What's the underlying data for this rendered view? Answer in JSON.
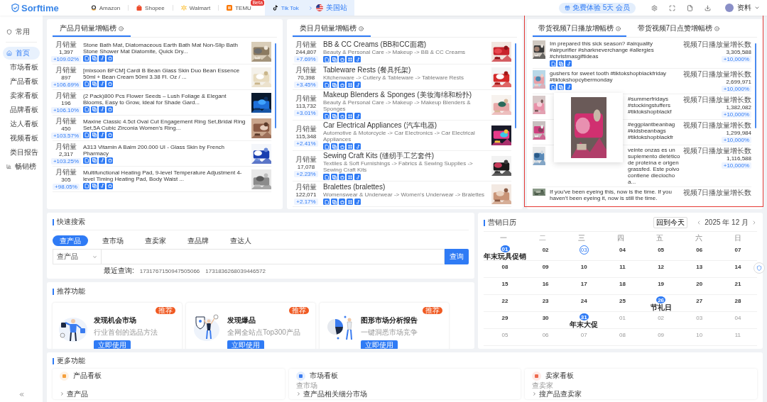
{
  "topbar": {
    "logo": "Sorftime",
    "platforms": [
      {
        "label": "Amazon",
        "selected": false
      },
      {
        "label": "Shopee",
        "selected": false
      },
      {
        "label": "Walmart",
        "selected": false
      },
      {
        "label": "TEMU",
        "selected": false,
        "badge": "Beta"
      },
      {
        "label": "Tik Tok",
        "selected": true,
        "site": "美国站"
      }
    ],
    "promo": "免费体验 5天 会员",
    "user": "资料"
  },
  "sidebar": {
    "items": [
      {
        "label": "常用",
        "selected": false
      },
      {
        "label": "首页",
        "selected": true
      },
      {
        "label": "市场看板",
        "selected": false
      },
      {
        "label": "产品看板",
        "selected": false
      },
      {
        "label": "卖家看板",
        "selected": false
      },
      {
        "label": "品牌看板",
        "selected": false
      },
      {
        "label": "达人看板",
        "selected": false
      },
      {
        "label": "视频看板",
        "selected": false
      },
      {
        "label": "类目报告",
        "selected": false
      },
      {
        "label": "畅销榜",
        "selected": false
      }
    ]
  },
  "product_ranking": {
    "title": "产品月销量增幅榜",
    "rows": [
      {
        "metric_label": "月销量",
        "sales": "1,397",
        "growth": "+109.02%",
        "title": "Stone Bath Mat, Diatomaceous Earth Bath Mat Non-Slip Bath Stone Shower Mat Diatomite, Quick Dry..."
      },
      {
        "metric_label": "月销量",
        "sales": "897",
        "growth": "+106.69%",
        "title": "[mixsoon BFCM] Cardi B Bean Glass Skin Duo Bean Essence 50ml + Bean Cream 50ml 3.38 Fl. Oz / ..."
      },
      {
        "metric_label": "月销量",
        "sales": "196",
        "growth": "+106.10%",
        "title": "(2 Pack)800 Pcs Flower Seeds – Lush Foliage & Elegant Blooms, Easy to Grow, Ideal for Shade Gard..."
      },
      {
        "metric_label": "月销量",
        "sales": "450",
        "growth": "+103.57%",
        "title": "Maxine Classic 4.5ct Oval Cut Engagement Ring Set,Bridal Ring Set,5A Cubic Zirconia Women's Ring..."
      },
      {
        "metric_label": "月销量",
        "sales": "2,317",
        "growth": "+103.25%",
        "title": "A313 Vitamin A Balm 200.000 UI - Glass Skin by French Pharmacy"
      },
      {
        "metric_label": "月销量",
        "sales": "305",
        "growth": "+98.05%",
        "title": "Multifunctional Heating Pad, 9-level Temperature Adjustment 4-level Timing Heating Pad, Body Waist ..."
      }
    ]
  },
  "category_ranking": {
    "title": "类目月销量增幅榜",
    "rows": [
      {
        "metric_label": "月销量",
        "sales": "244,807",
        "growth": "+7.69%",
        "title": "BB & CC Creams (BB和CC面霜)",
        "path": "Beauty & Personal Care -> Makeup -> BB & CC Creams"
      },
      {
        "metric_label": "月销量",
        "sales": "70,398",
        "growth": "+3.45%",
        "title": "Tableware Rests (餐具托架)",
        "path": "Kitchenware -> Cutlery & Tableware -> Tableware Rests"
      },
      {
        "metric_label": "月销量",
        "sales": "113,732",
        "growth": "+3.01%",
        "title": "Makeup Blenders & Sponges (美妆海绵和粉扑)",
        "path": "Beauty & Personal Care -> Makeup -> Makeup Blenders & Sponges"
      },
      {
        "metric_label": "月销量",
        "sales": "115,348",
        "growth": "+2.41%",
        "title": "Car Electrical Appliances (汽车电器)",
        "path": "Automotive & Motorcycle -> Car Electronics -> Car Electrical Appliances"
      },
      {
        "metric_label": "月销量",
        "sales": "17,078",
        "growth": "+2.23%",
        "title": "Sewing Craft Kits (缝纫手工艺套件)",
        "path": "Textiles & Soft Furnishings -> Fabrics & Sewing Supplies -> Sewing Craft Kits"
      },
      {
        "metric_label": "月销量",
        "sales": "122,071",
        "growth": "+2.17%",
        "title": "Bralettes (bralettes)",
        "path": "Womenswear & Underwear -> Women's Underwear -> Bralettes"
      }
    ]
  },
  "video_ranking": {
    "tabs": [
      {
        "label": "带货视频7日播放增幅榜",
        "selected": true
      },
      {
        "label": "带货视频7日点赞增幅榜",
        "selected": false
      }
    ],
    "rows": [
      {
        "title": "Im prepared this sick season? #airquality #airpurifier #sharkneverchange #allergies #christmasgiftideas",
        "covered": false,
        "metric_label": "视频7日播放量增长数",
        "value": "3,305,588",
        "growth": "+10,000%"
      },
      {
        "title": "gushers for sweet tooth #tiktokshopblackfriday #tiktokshopcybermonday",
        "covered": false,
        "metric_label": "视频7日播放量增长数",
        "value": "2,699,971",
        "growth": "+10,000%"
      },
      {
        "title": "#summerfridays #stockingstuffers #tiktokshopblackf",
        "covered": true,
        "metric_label": "视频7日播放量增长数",
        "value": "1,382,082",
        "growth": "+10,000%"
      },
      {
        "title": "#eggplantbeanbag #kidsbeanbags #tiktokshopblackfr",
        "covered": true,
        "metric_label": "视频7日播放量增长数",
        "value": "1,299,984",
        "growth": "+10,000%"
      },
      {
        "title": "veinte onzas es un suplemento dietético de proteína e origen grassfed. Este polvo contiene dieciocho a...",
        "covered": true,
        "metric_label": "视频7日播放量增长数",
        "value": "1,116,588",
        "growth": "+10,000%"
      },
      {
        "title": "If you've been eyeing this, now is the time. If you haven't been eyeing it, now is still the time.",
        "covered": false,
        "metric_label": "视频7日播放量增长数"
      }
    ]
  },
  "quick_search": {
    "title": "快速搜索",
    "tabs": [
      {
        "label": "查产品",
        "selected": true
      },
      {
        "label": "查市场",
        "selected": false
      },
      {
        "label": "查卖家",
        "selected": false
      },
      {
        "label": "查品牌",
        "selected": false
      },
      {
        "label": "查达人",
        "selected": false
      }
    ],
    "scope": "查产品",
    "button": "查询",
    "recent_label": "最近查询:",
    "recent": [
      "1731767150947505066",
      "1731836268039446572"
    ]
  },
  "recommended": {
    "title": "推荐功能",
    "cards": [
      {
        "badge": "推荐",
        "title": "发现机会市场",
        "subtitle": "行业首创的选品方法",
        "button": "立即使用"
      },
      {
        "badge": "推荐",
        "title": "发现爆品",
        "subtitle": "全网全站点Top300产品",
        "button": "立即使用"
      },
      {
        "badge": "推荐",
        "title": "图形市场分析报告",
        "subtitle": "一键洞悉市场竞争",
        "button": "立即使用"
      }
    ]
  },
  "calendar": {
    "title": "营销日历",
    "today_button": "回到今天",
    "month": "2025 年 12 月",
    "weekdays": [
      "一",
      "二",
      "三",
      "四",
      "五",
      "六",
      "日"
    ],
    "days": [
      {
        "day": "01",
        "kind": "event",
        "event": "年末玩具促销"
      },
      {
        "day": "02",
        "kind": "plain"
      },
      {
        "day": "03",
        "kind": "today"
      },
      {
        "day": "04",
        "kind": "plain"
      },
      {
        "day": "05",
        "kind": "plain"
      },
      {
        "day": "06",
        "kind": "plain"
      },
      {
        "day": "07",
        "kind": "plain"
      },
      {
        "day": "08",
        "kind": "plain"
      },
      {
        "day": "09",
        "kind": "plain"
      },
      {
        "day": "10",
        "kind": "plain"
      },
      {
        "day": "11",
        "kind": "plain"
      },
      {
        "day": "12",
        "kind": "plain"
      },
      {
        "day": "13",
        "kind": "plain"
      },
      {
        "day": "14",
        "kind": "plain"
      },
      {
        "day": "15",
        "kind": "plain"
      },
      {
        "day": "16",
        "kind": "plain"
      },
      {
        "day": "17",
        "kind": "plain"
      },
      {
        "day": "18",
        "kind": "plain"
      },
      {
        "day": "19",
        "kind": "plain"
      },
      {
        "day": "20",
        "kind": "plain"
      },
      {
        "day": "21",
        "kind": "plain"
      },
      {
        "day": "22",
        "kind": "plain"
      },
      {
        "day": "23",
        "kind": "plain"
      },
      {
        "day": "24",
        "kind": "plain"
      },
      {
        "day": "25",
        "kind": "plain"
      },
      {
        "day": "26",
        "kind": "event",
        "event": "节礼日"
      },
      {
        "day": "27",
        "kind": "plain"
      },
      {
        "day": "28",
        "kind": "plain"
      },
      {
        "day": "29",
        "kind": "plain"
      },
      {
        "day": "30",
        "kind": "plain"
      },
      {
        "day": "31",
        "kind": "event",
        "event": "年末大促"
      },
      {
        "day": "01",
        "kind": "outside"
      },
      {
        "day": "02",
        "kind": "outside"
      },
      {
        "day": "03",
        "kind": "outside"
      },
      {
        "day": "04",
        "kind": "outside"
      },
      {
        "day": "05",
        "kind": "outside"
      },
      {
        "day": "06",
        "kind": "outside"
      },
      {
        "day": "07",
        "kind": "outside"
      },
      {
        "day": "08",
        "kind": "outside"
      },
      {
        "day": "09",
        "kind": "outside"
      },
      {
        "day": "10",
        "kind": "outside"
      },
      {
        "day": "11",
        "kind": "outside"
      }
    ]
  },
  "more_functions": {
    "title": "更多功能",
    "cards": [
      {
        "title": "产品看板",
        "color": "#f5a03c",
        "links": [
          "查产品"
        ]
      },
      {
        "title": "市场看板",
        "color": "#3b7cf0",
        "section": "查市场",
        "links": [
          "查产品相关细分市场"
        ]
      },
      {
        "title": "卖家看板",
        "color": "#ee6a4f",
        "section": "查卖家",
        "links": [
          "搜产品查卖家"
        ]
      }
    ]
  }
}
